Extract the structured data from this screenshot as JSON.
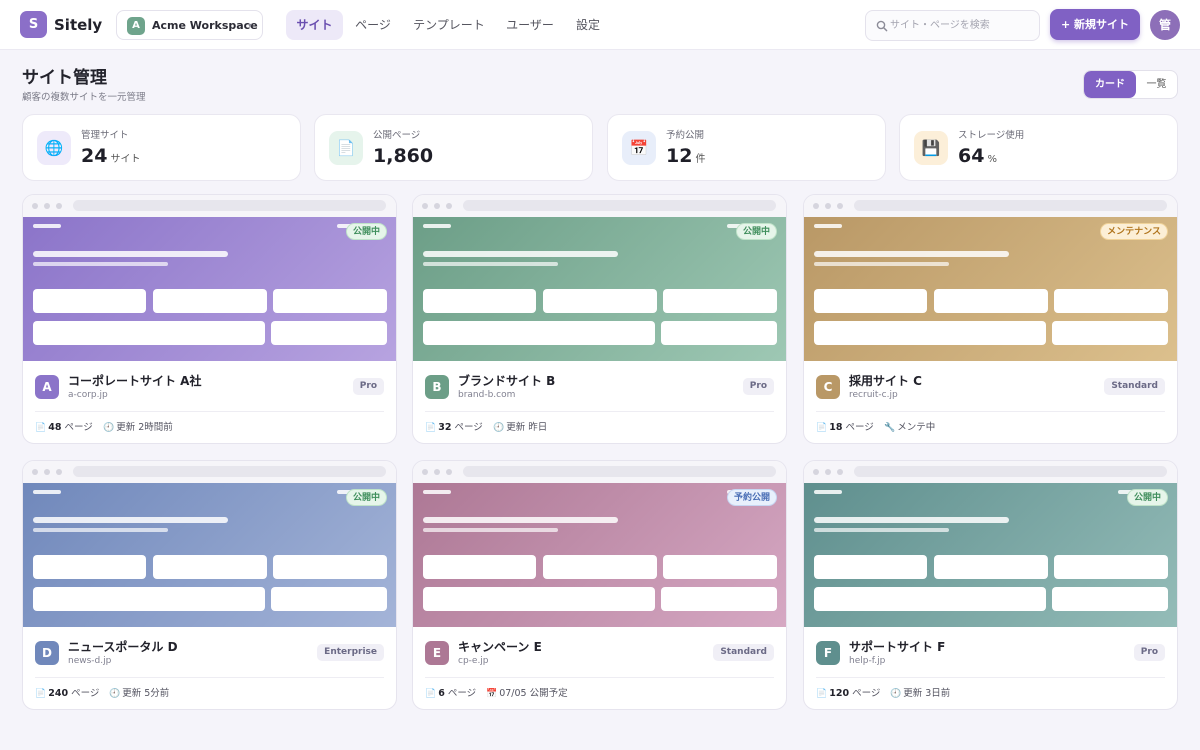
{
  "header": {
    "logo_letter": "S",
    "app_name": "Sitely",
    "workspace": {
      "avatar": "A",
      "name": "Acme Workspace",
      "chevron": "▾"
    },
    "tabs": [
      {
        "label": "サイト",
        "active": true
      },
      {
        "label": "ページ",
        "active": false
      },
      {
        "label": "テンプレート",
        "active": false
      },
      {
        "label": "ユーザー",
        "active": false
      },
      {
        "label": "設定",
        "active": false
      }
    ],
    "search": {
      "placeholder": "サイト・ページを検索",
      "value": ""
    },
    "new_site_label": "+ 新規サイト",
    "user_avatar": "管"
  },
  "page": {
    "title": "サイト管理",
    "subtitle": "顧客の複数サイトを一元管理",
    "view_toggle": [
      {
        "label": "カード",
        "active": true
      },
      {
        "label": "一覧",
        "active": false
      }
    ]
  },
  "stats": [
    {
      "icon": "globe-icon",
      "glyph": "🌐",
      "label": "管理サイト",
      "value": "24",
      "unit": "サイト"
    },
    {
      "icon": "page-icon",
      "glyph": "📄",
      "label": "公開ページ",
      "value": "1,860",
      "unit": ""
    },
    {
      "icon": "calendar-icon",
      "glyph": "📅",
      "label": "予約公開",
      "value": "12",
      "unit": "件"
    },
    {
      "icon": "floppy-icon",
      "glyph": "💾",
      "label": "ストレージ使用",
      "value": "64",
      "unit": "%"
    }
  ],
  "sites": [
    {
      "avatar": "A",
      "name": "コーポレートサイト A社",
      "domain": "a-corp.jp",
      "plan": "Pro",
      "status": "公開中",
      "status_type": "live",
      "pages_count": "48",
      "pages_unit": "ページ",
      "meta_icon": "clock-icon",
      "meta_glyph": "🕘",
      "meta_text": "更新 2時間前",
      "color_a": "#8b74c9",
      "color_b": "#b7a3e0"
    },
    {
      "avatar": "B",
      "name": "ブランドサイト B",
      "domain": "brand-b.com",
      "plan": "Pro",
      "status": "公開中",
      "status_type": "live",
      "pages_count": "32",
      "pages_unit": "ページ",
      "meta_icon": "clock-icon",
      "meta_glyph": "🕘",
      "meta_text": "更新 昨日",
      "color_a": "#6c9e87",
      "color_b": "#9ec8b4"
    },
    {
      "avatar": "C",
      "name": "採用サイト C",
      "domain": "recruit-c.jp",
      "plan": "Standard",
      "status": "メンテナンス",
      "status_type": "maint",
      "pages_count": "18",
      "pages_unit": "ページ",
      "meta_icon": "wrench-icon",
      "meta_glyph": "🔧",
      "meta_text": "メンテ中",
      "color_a": "#b99866",
      "color_b": "#dcc08d"
    },
    {
      "avatar": "D",
      "name": "ニュースポータル D",
      "domain": "news-d.jp",
      "plan": "Enterprise",
      "status": "公開中",
      "status_type": "live",
      "pages_count": "240",
      "pages_unit": "ページ",
      "meta_icon": "clock-icon",
      "meta_glyph": "🕘",
      "meta_text": "更新 5分前",
      "color_a": "#7088bb",
      "color_b": "#a4b4d8"
    },
    {
      "avatar": "E",
      "name": "キャンペーン E",
      "domain": "cp-e.jp",
      "plan": "Standard",
      "status": "予約公開",
      "status_type": "sched",
      "pages_count": "6",
      "pages_unit": "ページ",
      "meta_icon": "calendar-icon",
      "meta_glyph": "📅",
      "meta_text": "07/05 公開予定",
      "color_a": "#ad7895",
      "color_b": "#d6a8c3"
    },
    {
      "avatar": "F",
      "name": "サポートサイト F",
      "domain": "help-f.jp",
      "plan": "Pro",
      "status": "公開中",
      "status_type": "live",
      "pages_count": "120",
      "pages_unit": "ページ",
      "meta_icon": "clock-icon",
      "meta_glyph": "🕘",
      "meta_text": "更新 3日前",
      "color_a": "#5f8f8e",
      "color_b": "#94bcb8"
    }
  ]
}
